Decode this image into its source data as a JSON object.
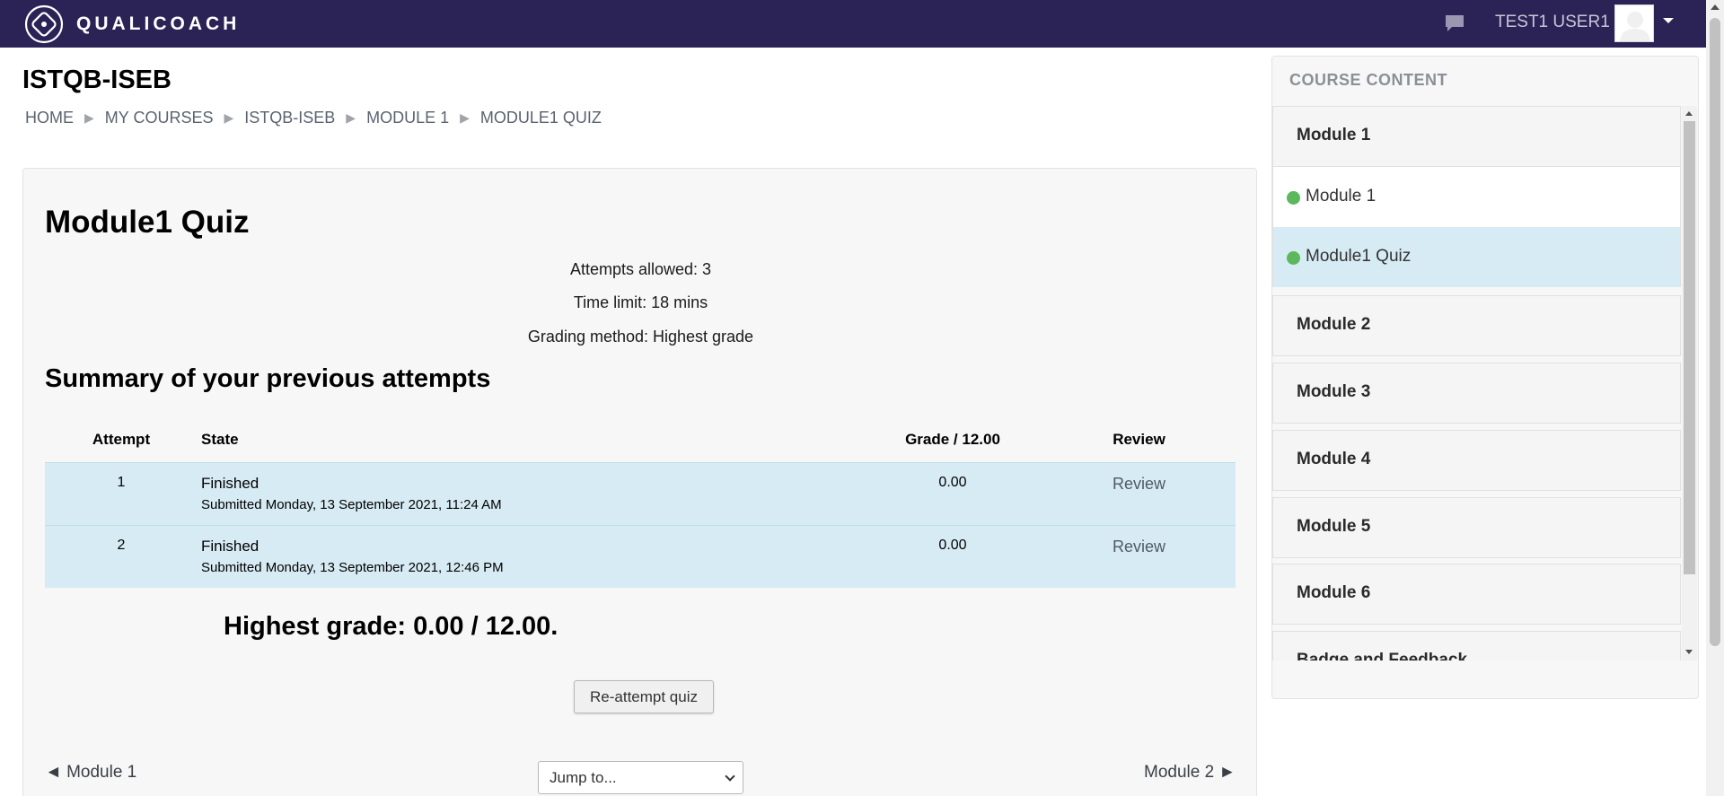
{
  "brand": {
    "name": "QUALICOACH",
    "logo_icon": "qualicoach-logo-icon"
  },
  "header": {
    "user_name": "TEST1 USER1",
    "messages_icon": "chat-bubble-icon"
  },
  "course_title": "ISTQB-ISEB",
  "breadcrumb": [
    "HOME",
    "MY COURSES",
    "ISTQB-ISEB",
    "MODULE 1",
    "MODULE1 QUIZ"
  ],
  "breadcrumb_separator": "▶",
  "quiz": {
    "title": "Module1 Quiz",
    "attempts_allowed": "Attempts allowed: 3",
    "time_limit": "Time limit: 18 mins",
    "grading_method": "Grading method: Highest grade",
    "summary_title": "Summary of your previous attempts",
    "table": {
      "headers": {
        "attempt": "Attempt",
        "state": "State",
        "grade": "Grade / 12.00",
        "review": "Review"
      },
      "rows": [
        {
          "attempt": "1",
          "state": "Finished",
          "submitted": "Submitted Monday, 13 September 2021, 11:24 AM",
          "grade": "0.00",
          "review": "Review"
        },
        {
          "attempt": "2",
          "state": "Finished",
          "submitted": "Submitted Monday, 13 September 2021, 12:46 PM",
          "grade": "0.00",
          "review": "Review"
        }
      ]
    },
    "highest_grade": "Highest grade: 0.00 / 12.00.",
    "reattempt_label": "Re-attempt quiz"
  },
  "navigation": {
    "prev_label": "◄ Module 1",
    "next_label": "Module 2 ►",
    "jump_placeholder": "Jump to..."
  },
  "sidebar": {
    "title": "COURSE CONTENT",
    "sections": [
      {
        "label": "Module 1"
      },
      {
        "label": "Module 2"
      },
      {
        "label": "Module 3"
      },
      {
        "label": "Module 4"
      },
      {
        "label": "Module 5"
      },
      {
        "label": "Module 6"
      },
      {
        "label": "Badge and Feedback"
      }
    ],
    "activities": [
      {
        "label": "Module 1",
        "status": "complete"
      },
      {
        "label": "Module1 Quiz",
        "status": "complete",
        "current": true
      }
    ]
  },
  "colors": {
    "navbar": "#2b2356",
    "table_row": "#d7ebf4",
    "active_item": "#d7ebf4",
    "complete_dot": "#5cb85c"
  }
}
